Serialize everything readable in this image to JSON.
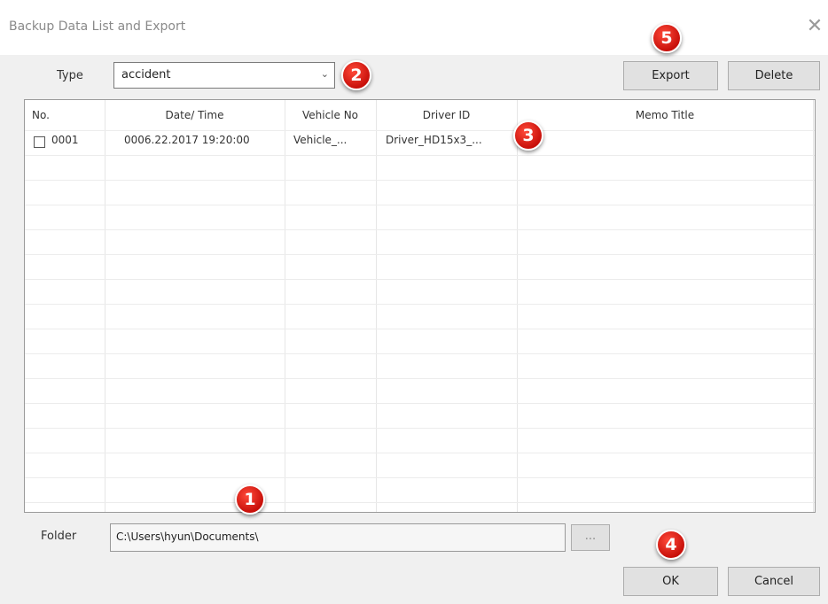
{
  "window": {
    "title": "Backup Data List and Export",
    "close_glyph": "✕"
  },
  "type": {
    "label": "Type",
    "selected": "accident",
    "arrow": "⌄"
  },
  "buttons": {
    "export": "Export",
    "delete": "Delete",
    "browse": "...",
    "ok": "OK",
    "cancel": "Cancel"
  },
  "table": {
    "columns": [
      "No.",
      "Date/ Time",
      "Vehicle No",
      "Driver ID",
      "Memo Title"
    ],
    "rows": [
      {
        "no": "0001",
        "datetime": "0006.22.2017 19:20:00",
        "vehicle": "Vehicle_...",
        "driver": "Driver_HD15x3_...",
        "memo": ""
      }
    ]
  },
  "folder": {
    "label": "Folder",
    "path": "C:\\Users\\hyun\\Documents\\"
  },
  "badges": [
    "1",
    "2",
    "3",
    "4",
    "5"
  ]
}
